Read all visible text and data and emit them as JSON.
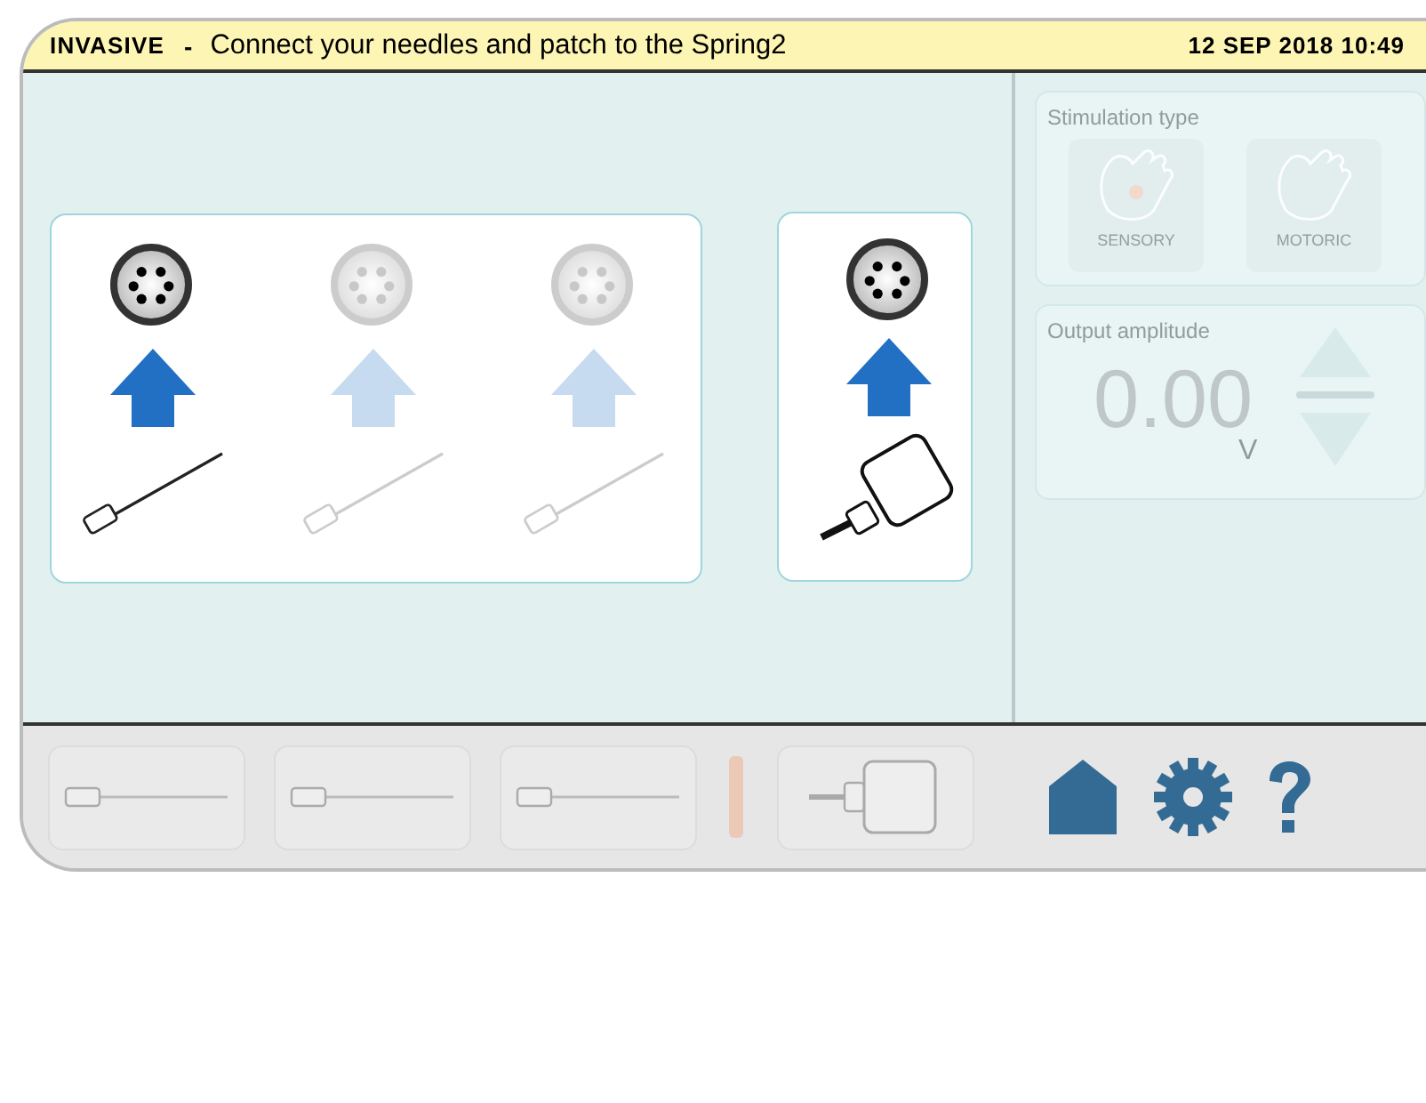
{
  "header": {
    "mode": "INVASIVE",
    "separator": "-",
    "message": "Connect your needles and patch to the Spring2",
    "datetime": "12 SEP 2018 10:49"
  },
  "electrode_groups": [
    {
      "kind": "needles",
      "items": [
        {
          "kind": "needle",
          "connected": true
        },
        {
          "kind": "needle",
          "connected": false
        },
        {
          "kind": "needle",
          "connected": false
        }
      ]
    },
    {
      "kind": "patch",
      "items": [
        {
          "kind": "patch",
          "connected": true
        }
      ]
    }
  ],
  "stimulation_type": {
    "title": "Stimulation type",
    "disabled": true,
    "options": [
      {
        "label": "SENSORY",
        "kind": "sensory",
        "selected": false
      },
      {
        "label": "MOTORIC",
        "kind": "motoric",
        "selected": false
      }
    ]
  },
  "output_amplitude": {
    "title": "Output amplitude",
    "value": "0.00",
    "unit": "V",
    "disabled": true
  },
  "toolbar": [
    {
      "kind": "slider"
    },
    {
      "kind": "slider"
    },
    {
      "kind": "slider"
    },
    {
      "kind": "indicator"
    },
    {
      "kind": "patch"
    },
    {
      "kind": "home"
    },
    {
      "kind": "settings"
    },
    {
      "kind": "help"
    }
  ]
}
